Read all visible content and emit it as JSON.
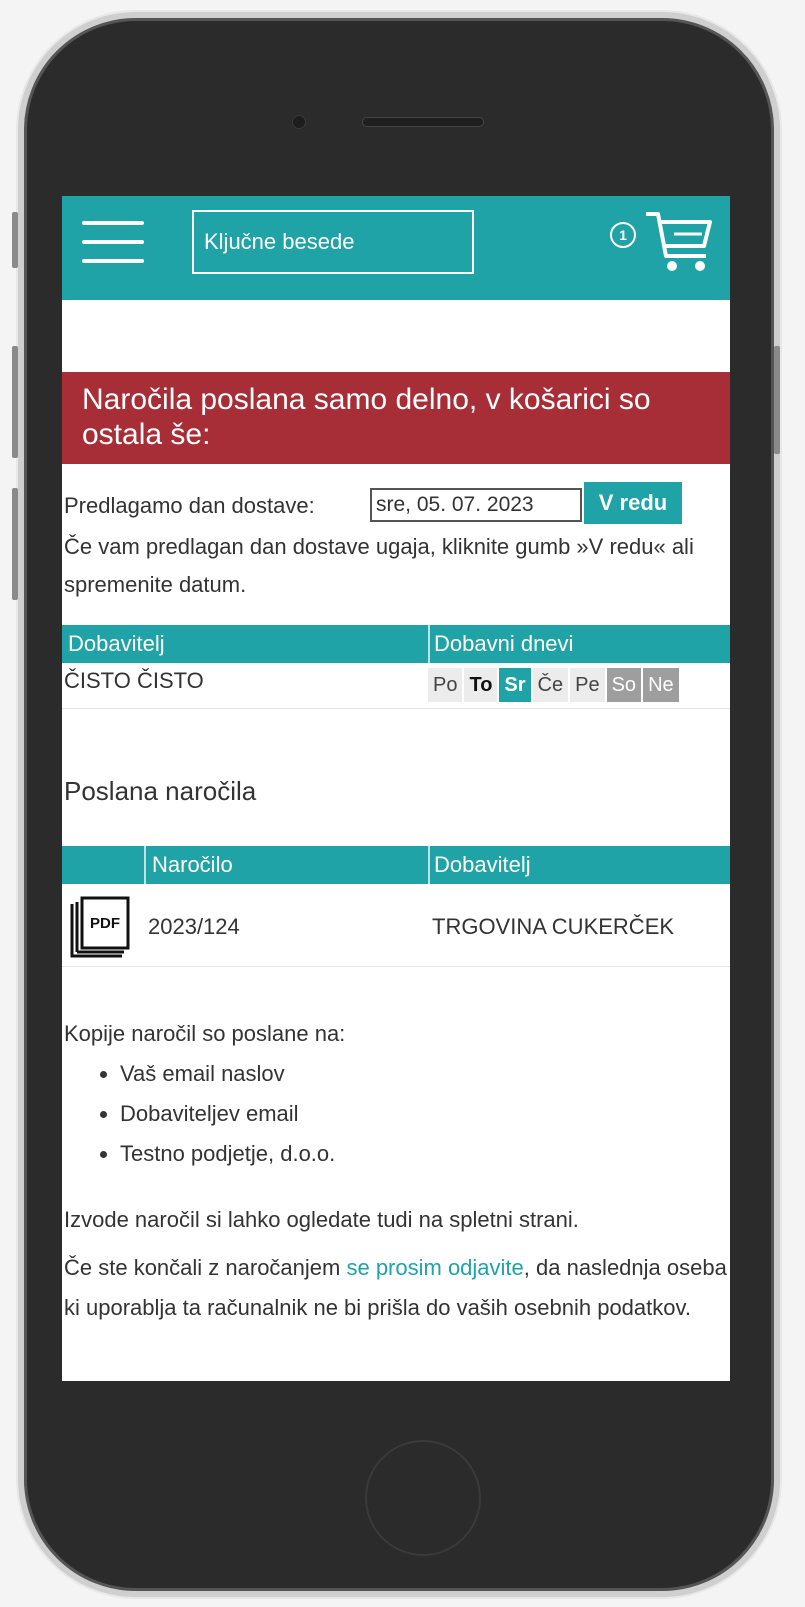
{
  "header": {
    "search_placeholder": "Ključne besede",
    "cart_count": "1"
  },
  "alert": {
    "text": "Naročila poslana samo delno, v košarici so ostala še:"
  },
  "delivery": {
    "label": "Predlagamo dan dostave:",
    "date_value": "sre, 05. 07. 2023",
    "ok_label": "V redu",
    "hint": "Če vam predlagan dan dostave ugaja, kliknite gumb »V redu« ali spremenite datum."
  },
  "supplier_table": {
    "headers": [
      "Dobavitelj",
      "Dobavni dnevi"
    ],
    "row": {
      "name": "ČISTO ČISTO",
      "days": [
        "Po",
        "To",
        "Sr",
        "Če",
        "Pe",
        "So",
        "Ne"
      ]
    }
  },
  "orders": {
    "title": "Poslana naročila",
    "headers": [
      "Naročilo",
      "Dobavitelj"
    ],
    "rows": [
      {
        "icon": "pdf-icon",
        "icon_text": "PDF",
        "number": "2023/124",
        "supplier": "TRGOVINA CUKERČEK"
      }
    ]
  },
  "copies": {
    "intro": "Kopije naročil so poslane na:",
    "items": [
      "Vaš email naslov",
      "Dobaviteljev email",
      "Testno podjetje, d.o.o."
    ]
  },
  "extract_text": "Izvode naročil si lahko ogledate tudi na spletni strani.",
  "logout": {
    "before": "Če ste končali z naročanjem ",
    "link": "se prosim odjavite",
    "after": ", da naslednja oseba ki uporablja ta računalnik ne bi prišla do vaših osebnih podatkov."
  },
  "colors": {
    "accent": "#1fa3a6",
    "alert": "#a72e36",
    "weekend": "#9e9e9e"
  }
}
